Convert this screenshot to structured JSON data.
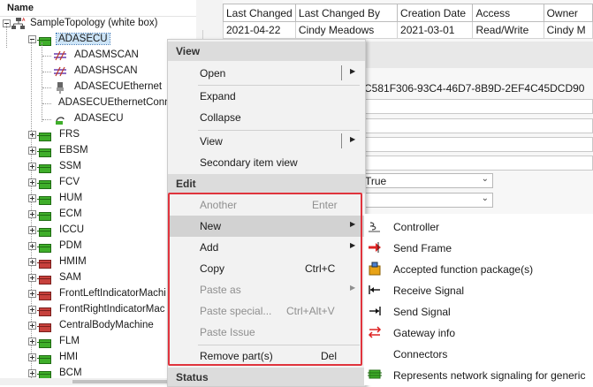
{
  "tree": {
    "column_header": "Name",
    "root": {
      "label": "SampleTopology (white box)"
    },
    "selected": {
      "label": "ADASECU"
    },
    "children": [
      {
        "label": "ADASMSCAN",
        "icon": "can-bus-icon"
      },
      {
        "label": "ADASHSCAN",
        "icon": "can-bus-icon"
      },
      {
        "label": "ADASECUEthernet",
        "icon": "ethernet-connector-icon"
      },
      {
        "label": "ADASECUEthernetConne",
        "icon": "none"
      },
      {
        "label": "ADASECU",
        "icon": "connector-icon"
      }
    ],
    "ecus": [
      {
        "label": "FRS",
        "color": "green"
      },
      {
        "label": "EBSM",
        "color": "green"
      },
      {
        "label": "SSM",
        "color": "green"
      },
      {
        "label": "FCV",
        "color": "green"
      },
      {
        "label": "HUM",
        "color": "green"
      },
      {
        "label": "ECM",
        "color": "green"
      },
      {
        "label": "ICCU",
        "color": "green"
      },
      {
        "label": "PDM",
        "color": "green"
      },
      {
        "label": "HMIM",
        "color": "red"
      },
      {
        "label": "SAM",
        "color": "red"
      },
      {
        "label": "FrontLeftIndicatorMachi",
        "color": "red"
      },
      {
        "label": "FrontRightIndicatorMac",
        "color": "red"
      },
      {
        "label": "CentralBodyMachine",
        "color": "red"
      },
      {
        "label": "FLM",
        "color": "green"
      },
      {
        "label": "HMI",
        "color": "green"
      },
      {
        "label": "BCM",
        "color": "green"
      }
    ]
  },
  "properties": {
    "headers": [
      "Last Changed",
      "Last Changed By",
      "Creation Date",
      "Access",
      "Owner"
    ],
    "row": [
      "2021-04-22",
      "Cindy Meadows",
      "2021-03-01",
      "Read/Write",
      "Cindy M"
    ],
    "guid": "C581F306-93C4-46D7-8B9D-2EF4C45DCD90",
    "combo1_value": "True",
    "combo2_value": ""
  },
  "context_menu": {
    "sections": {
      "view": "View",
      "edit": "Edit",
      "status": "Status"
    },
    "view_items": [
      {
        "label": "Open",
        "shortcut": "",
        "submenu": true,
        "split": true
      },
      {
        "label": "Expand"
      },
      {
        "label": "Collapse"
      },
      {
        "label": "View",
        "submenu": true,
        "split": true
      },
      {
        "label": "Secondary item view"
      }
    ],
    "edit_items": [
      {
        "label": "Another",
        "shortcut": "Enter",
        "disabled": true
      },
      {
        "label": "New",
        "submenu": true,
        "highlighted": true
      },
      {
        "label": "Add",
        "submenu": true
      },
      {
        "label": "Copy",
        "shortcut": "Ctrl+C"
      },
      {
        "label": "Paste as",
        "submenu": true,
        "disabled": true
      },
      {
        "label": "Paste special...",
        "shortcut": "Ctrl+Alt+V",
        "disabled": true
      },
      {
        "label": "Paste Issue",
        "disabled": true
      },
      {
        "label": "Remove part(s)",
        "shortcut": "Del"
      }
    ],
    "highlight_color": "#e0343d"
  },
  "submenu": [
    {
      "label": "Controller",
      "icon": "controller-icon"
    },
    {
      "label": "Send Frame",
      "icon": "send-frame-icon"
    },
    {
      "label": "Accepted function package(s)",
      "icon": "package-icon"
    },
    {
      "label": "Receive Signal",
      "icon": "receive-signal-icon"
    },
    {
      "label": "Send Signal",
      "icon": "send-signal-icon"
    },
    {
      "label": "Gateway info",
      "icon": "gateway-icon"
    },
    {
      "label": "Connectors",
      "icon": "none"
    },
    {
      "label": "Represents network signaling for generic",
      "icon": "network-signaling-icon"
    }
  ]
}
